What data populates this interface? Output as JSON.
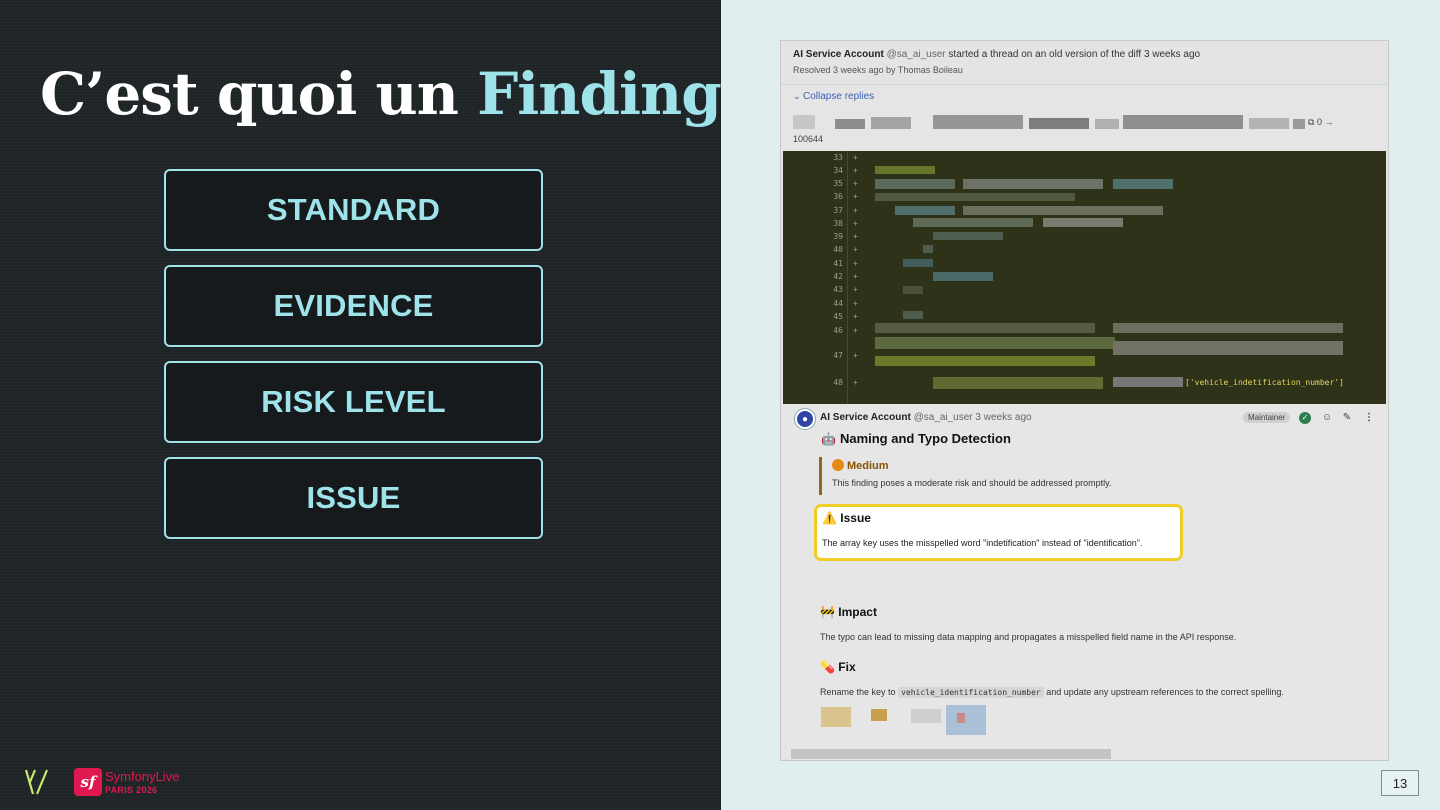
{
  "slide": {
    "title_prefix": "C’est quoi un",
    "title_accent": "Finding",
    "title_suffix": " ?",
    "cards": [
      "STANDARD",
      "EVIDENCE",
      "RISK LEVEL",
      "ISSUE"
    ],
    "page_number": "13",
    "event": {
      "name": "SymfonyLive",
      "sub": "PARIS 2026",
      "logo_letter": "sf"
    }
  },
  "screenshot": {
    "thread": {
      "author": "AI Service Account",
      "handle": "@sa_ai_user",
      "action": "started a thread on an old version of the diff",
      "time": "3 weeks ago",
      "resolved": "Resolved 3 weeks ago by Thomas Boileau"
    },
    "collapse_label": "Collapse replies",
    "file_mode": "100644",
    "file_count": "0 →",
    "code": {
      "line_numbers": [
        "33",
        "34",
        "35",
        "36",
        "37",
        "38",
        "39",
        "40",
        "41",
        "42",
        "43",
        "44",
        "45",
        "46",
        "47",
        "48"
      ],
      "tail_text": "['vehicle_indetification_number']"
    },
    "comment": {
      "author": "AI Service Account",
      "handle": "@sa_ai_user",
      "time": "3 weeks ago",
      "badge": "Maintainer",
      "heading": "Naming and Typo Detection",
      "risk_level": "Medium",
      "risk_desc": "This finding poses a moderate risk and should be addressed promptly.",
      "issue_title": "Issue",
      "issue_text": "The array key uses the misspelled word \"indetification\" instead of \"identification\".",
      "impact_title": "Impact",
      "impact_text": "The typo can lead to missing data mapping and propagates a misspelled field name in the API response.",
      "fix_title": "Fix",
      "fix_text_before": "Rename the key to",
      "fix_code": "vehicle_identification_number",
      "fix_text_after": "and update any upstream references to the correct spelling."
    }
  },
  "colors": {
    "accent": "#9fe3ea",
    "dark_bg": "#1e2325",
    "light_bg": "#e0eeef",
    "highlight": "#f1cd27",
    "symfony": "#e0184f"
  }
}
